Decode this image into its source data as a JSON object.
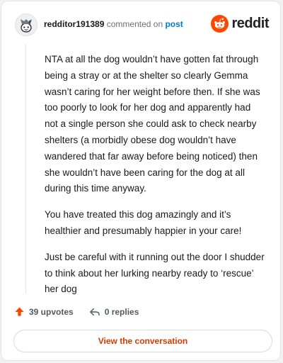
{
  "comment": {
    "username": "redditor191389",
    "commented_on_text": "commented on",
    "post_link": "post",
    "paragraphs": [
      "NTA at all the dog wouldn’t have gotten fat through being a stray or at the shelter so clearly Gemma wasn’t caring for her weight before then. If she was too poorly to look for her dog and apparently had not a single person she could ask to check nearby shelters (a morbidly obese dog wouldn’t have wandered that far away before being noticed) then she wouldn’t have been caring for the dog at all during this time anyway.",
      "You have treated this dog amazingly and it’s healthier and presumably happier in your care!",
      "Just be careful with it running out the door I shudder to think about her lurking nearby ready to ‘rescue’ her dog"
    ]
  },
  "brand": {
    "name": "reddit",
    "color": "#ff4500"
  },
  "actions": {
    "upvotes": "39 upvotes",
    "replies": "0 replies"
  },
  "footer": {
    "view_button": "View the conversation"
  },
  "colors": {
    "accent": "#ff4500",
    "link": "#0079d3",
    "button_text": "#d93900"
  }
}
